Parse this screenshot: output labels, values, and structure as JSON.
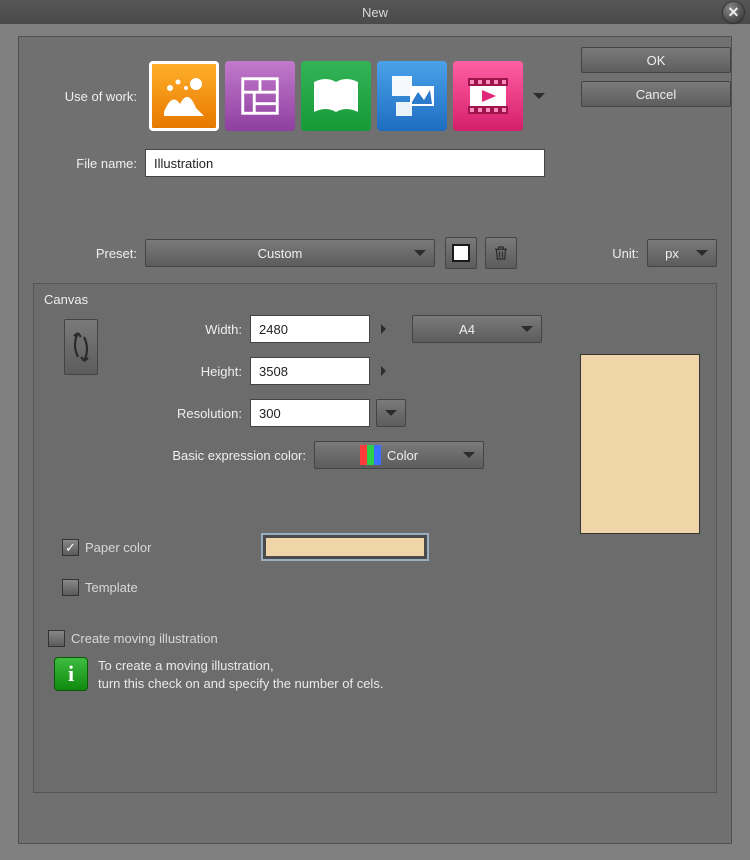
{
  "title": "New",
  "buttons": {
    "ok": "OK",
    "cancel": "Cancel"
  },
  "use_of_work_label": "Use of work:",
  "file_name_label": "File name:",
  "file_name_value": "Illustration",
  "preset_label": "Preset:",
  "preset_value": "Custom",
  "unit_label": "Unit:",
  "unit_value": "px",
  "canvas": {
    "title": "Canvas",
    "width_label": "Width:",
    "width_value": "2480",
    "height_label": "Height:",
    "height_value": "3508",
    "resolution_label": "Resolution:",
    "resolution_value": "300",
    "paper_preset": "A4",
    "basic_color_label": "Basic expression color:",
    "basic_color_value": "Color",
    "paper_color_label": "Paper color",
    "paper_color_hex": "#f0d5a8",
    "template_label": "Template"
  },
  "moving": {
    "checkbox_label": "Create moving illustration",
    "info_line1": "To create a moving illustration,",
    "info_line2": "turn this check on and specify the number of cels."
  }
}
